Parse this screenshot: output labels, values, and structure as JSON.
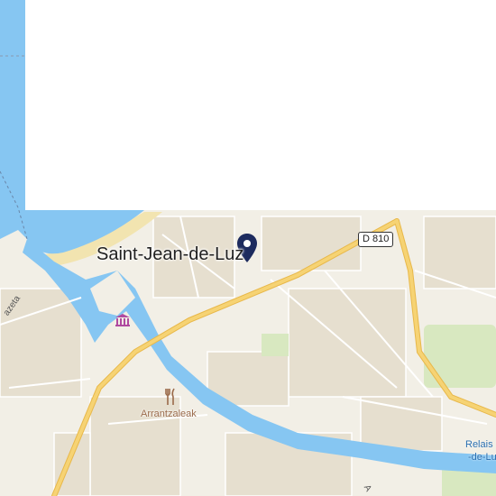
{
  "map": {
    "city_label": "Saint-Jean-de-Luz",
    "road_shield": "D 810",
    "pois": {
      "restaurant_label": "Arrantzaleak",
      "relais_label_line1": "Relais",
      "relais_label_line2": "-de-Luz"
    },
    "streets": {
      "left_street": "azeta",
      "bottom_road": "A"
    },
    "colors": {
      "water": "#86c6f2",
      "land": "#f2efe6",
      "major_road": "#f6d374",
      "marker": "#1d2b5e",
      "museum": "#b04aa0",
      "restaurant": "#9a6a4a"
    },
    "icons": {
      "marker": "map-pin-icon",
      "museum": "museum-icon",
      "restaurant": "restaurant-icon"
    }
  }
}
